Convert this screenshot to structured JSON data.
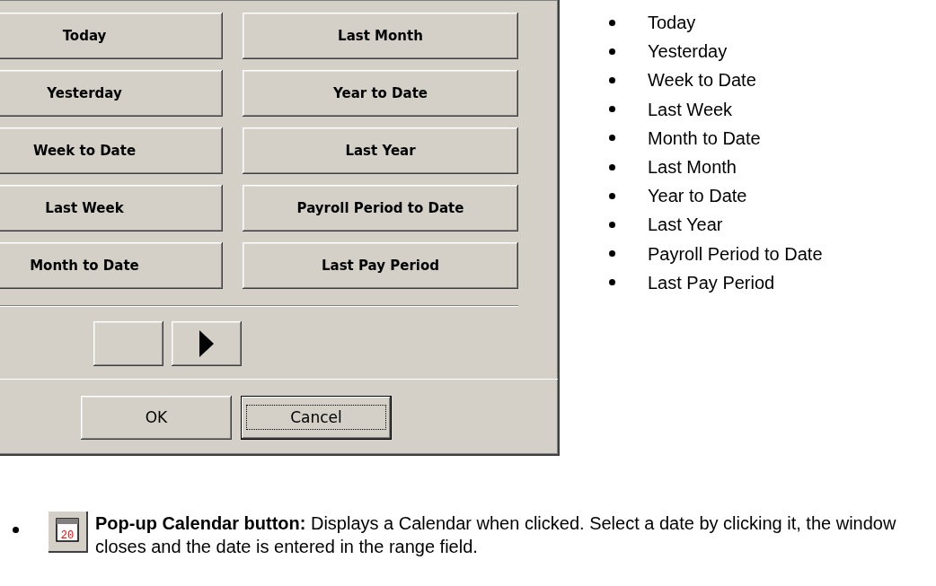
{
  "dialog": {
    "range_buttons": [
      {
        "label": "Today"
      },
      {
        "label": "Yesterday"
      },
      {
        "label": "Week to Date"
      },
      {
        "label": "Last Week"
      },
      {
        "label": "Month to Date"
      },
      {
        "label": "Last Month"
      },
      {
        "label": "Year to Date"
      },
      {
        "label": "Last Year"
      },
      {
        "label": "Payroll Period to Date"
      },
      {
        "label": "Last Pay Period"
      }
    ],
    "buttons": [
      {
        "label": "OK",
        "focused": false
      },
      {
        "label": "Cancel",
        "focused": true
      }
    ]
  },
  "range_list": [
    "Today",
    "Yesterday",
    "Week to Date",
    "Last Week",
    "Month to Date",
    "Last Month",
    "Year to Date",
    "Last Year",
    "Payroll Period to Date",
    "Last Pay Period"
  ],
  "note": {
    "icon_day": "20",
    "text": "**Pop-up Calendar button:**  Displays a Calendar when clicked. Select a date by clicking it, the window closes and the date is entered in the range field."
  }
}
